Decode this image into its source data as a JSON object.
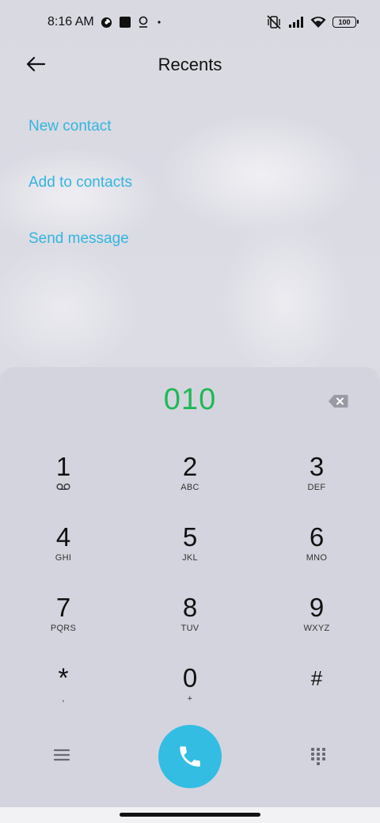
{
  "status_bar": {
    "time": "8:16 AM",
    "left_icons": [
      "data-saver-icon",
      "square-notification-icon",
      "location-pin-icon",
      "dot-icon"
    ],
    "right_icons": [
      "vibrate-off-icon",
      "signal-icon",
      "wifi-icon"
    ],
    "battery": "100"
  },
  "header": {
    "title": "Recents",
    "back_icon": "arrow-left-icon"
  },
  "actions": {
    "new_contact": "New contact",
    "add_to_contacts": "Add to contacts",
    "send_message": "Send message"
  },
  "dialer": {
    "number": "010",
    "backspace_icon": "backspace-icon",
    "keys": [
      {
        "digit": "1",
        "letters": ""
      },
      {
        "digit": "2",
        "letters": "ABC"
      },
      {
        "digit": "3",
        "letters": "DEF"
      },
      {
        "digit": "4",
        "letters": "GHI"
      },
      {
        "digit": "5",
        "letters": "JKL"
      },
      {
        "digit": "6",
        "letters": "MNO"
      },
      {
        "digit": "7",
        "letters": "PQRS"
      },
      {
        "digit": "8",
        "letters": "TUV"
      },
      {
        "digit": "9",
        "letters": "WXYZ"
      },
      {
        "digit": "*",
        "letters": ","
      },
      {
        "digit": "0",
        "letters": "+"
      },
      {
        "digit": "#",
        "letters": ""
      }
    ],
    "voicemail_icon": "voicemail-icon",
    "menu_icon": "hamburger-menu-icon",
    "call_icon": "phone-icon",
    "keypad_icon": "dialpad-icon"
  },
  "colors": {
    "accent": "#33b5de",
    "number": "#1db954",
    "call_button": "#33bde3"
  }
}
